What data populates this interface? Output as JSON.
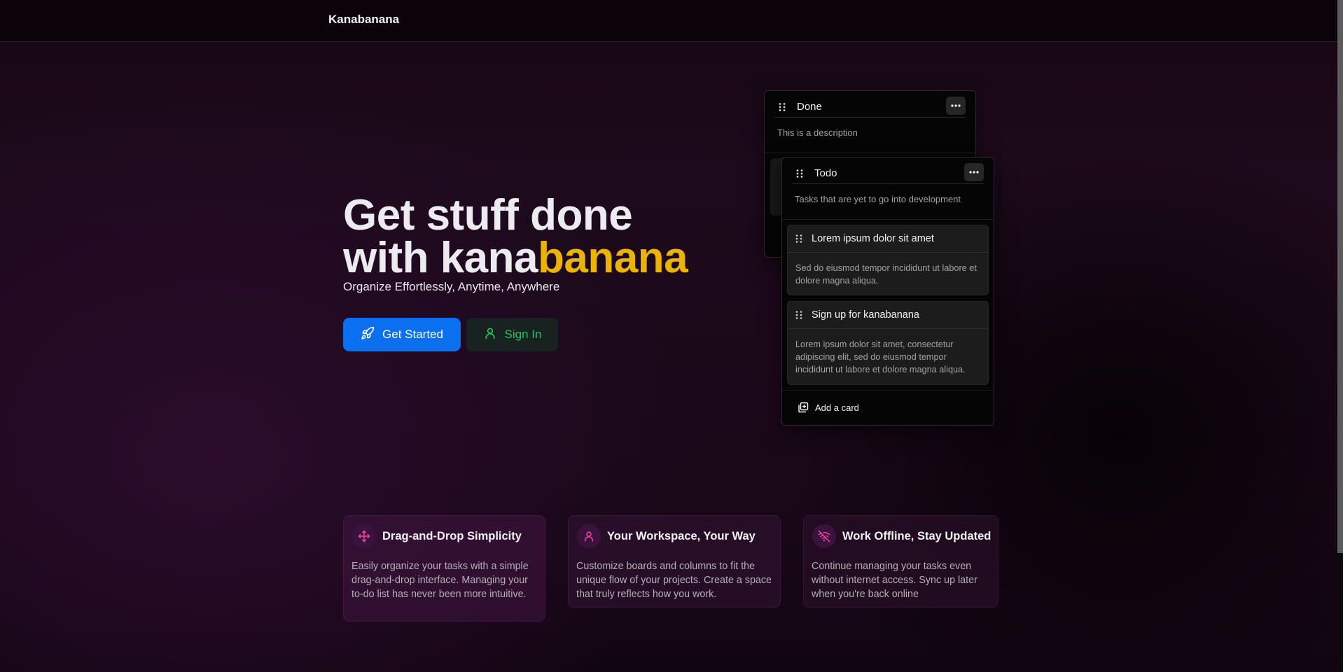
{
  "header": {
    "brand": "Kanabanana"
  },
  "hero": {
    "title_line1": "Get stuff done",
    "title_line2_prefix": "with kana",
    "title_line2_accent": "banana",
    "subtitle": "Organize Effortlessly, Anytime, Anywhere",
    "primary_button": "Get Started",
    "secondary_button": "Sign In",
    "accent_color": "#eab308",
    "primary_color": "#0a70f0",
    "secondary_text_color": "#22c55e"
  },
  "board": {
    "back_column": {
      "title": "Done",
      "description": "This is a description"
    },
    "front_column": {
      "title": "Todo",
      "description": "Tasks that are yet to go into development",
      "cards": [
        {
          "title": "Lorem ipsum dolor sit amet",
          "body": "Sed do eiusmod tempor incididunt ut labore et dolore magna aliqua."
        },
        {
          "title": "Sign up for kanabanana",
          "body": "Lorem ipsum dolor sit amet, consectetur adipiscing elit, sed do eiusmod tempor incididunt ut labore et dolore magna aliqua."
        }
      ],
      "add_card_label": "Add a card"
    }
  },
  "features": [
    {
      "icon": "move-icon",
      "title": "Drag-and-Drop Simplicity",
      "body": "Easily organize your tasks with a simple drag-and-drop interface. Managing your to-do list has never been more intuitive."
    },
    {
      "icon": "user-icon",
      "title": "Your Workspace, Your Way",
      "body": "Customize boards and columns to fit the unique flow of your projects. Create a space that truly reflects how you work."
    },
    {
      "icon": "wifi-off-icon",
      "title": "Work Offline, Stay Updated",
      "body": "Continue managing your tasks even without internet access. Sync up later when you're back online"
    }
  ]
}
